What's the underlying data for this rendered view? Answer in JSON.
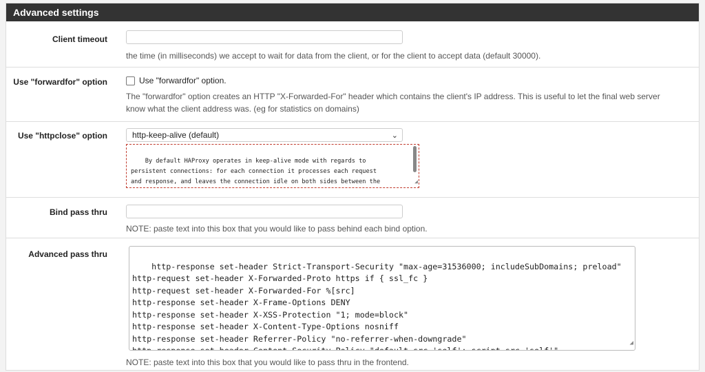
{
  "panel": {
    "title": "Advanced settings"
  },
  "client_timeout": {
    "label": "Client timeout",
    "value": "",
    "help": "the time (in milliseconds) we accept to wait for data from the client, or for the client to accept data (default 30000)."
  },
  "forwardfor": {
    "label": "Use \"forwardfor\" option",
    "checkbox_label": "Use \"forwardfor\" option.",
    "checked": false,
    "help_line1": "The \"forwardfor\" option creates an HTTP \"X-Forwarded-For\" header which contains the client's IP address. This is useful to let the final web server",
    "help_line2": "know what the client address was. (eg for statistics on domains)"
  },
  "httpclose": {
    "label": "Use \"httpclose\" option",
    "selected": "http-keep-alive (default)",
    "description": "By default HAProxy operates in keep-alive mode with regards to\npersistent connections: for each connection it processes each request\nand response, and leaves the connection idle on both sides between the\nend of a response and the start of a new request."
  },
  "bind_pass_thru": {
    "label": "Bind pass thru",
    "value": "",
    "help": "NOTE: paste text into this box that you would like to pass behind each bind option."
  },
  "advanced_pass_thru": {
    "label": "Advanced pass thru",
    "value": "http-response set-header Strict-Transport-Security \"max-age=31536000; includeSubDomains; preload\"\nhttp-request set-header X-Forwarded-Proto https if { ssl_fc }\nhttp-request set-header X-Forwarded-For %[src]\nhttp-response set-header X-Frame-Options DENY\nhttp-response set-header X-XSS-Protection \"1; mode=block\"\nhttp-response set-header X-Content-Type-Options nosniff\nhttp-response set-header Referrer-Policy \"no-referrer-when-downgrade\"\nhttp-response set-header Content-Security-Policy \"default-src 'self'; script-src 'self'\"",
    "help": "NOTE: paste text into this box that you would like to pass thru in the frontend."
  }
}
